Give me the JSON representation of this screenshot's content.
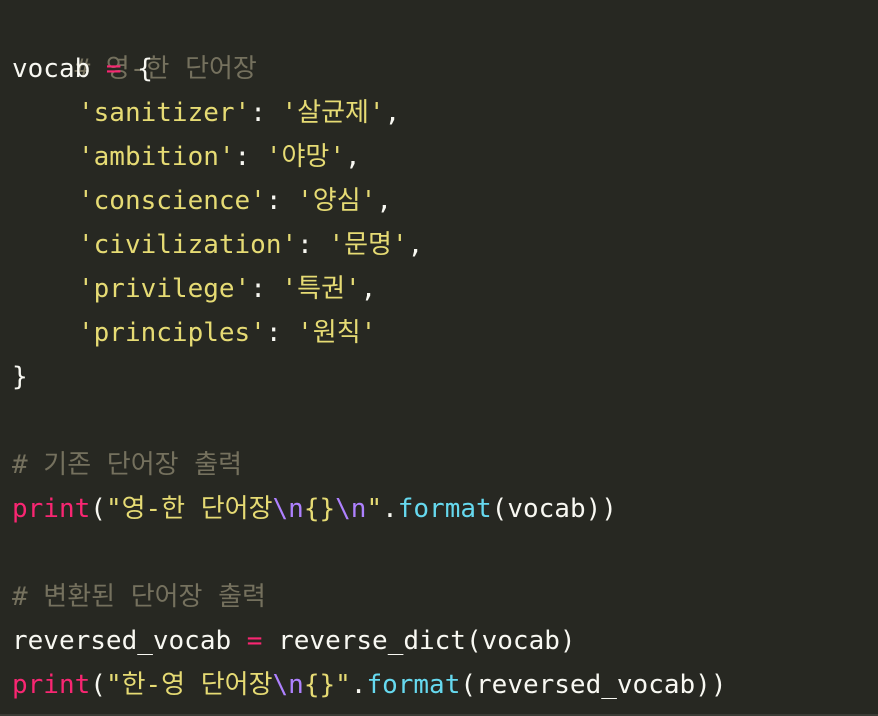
{
  "editor": {
    "colors": {
      "background": "#272822",
      "comment": "#75715e",
      "text": "#f8f8f2",
      "keyword": "#f92672",
      "string": "#e6db74",
      "escape": "#ae81ff",
      "method": "#66d9ef"
    },
    "lines": [
      {
        "comment": "# 영-한 단어장"
      },
      {
        "var": "vocab",
        "op": " = ",
        "brace": "{"
      },
      {
        "key": "'sanitizer'",
        "colon": ": ",
        "val": "'살균제'",
        "comma": ","
      },
      {
        "key": "'ambition'",
        "colon": ": ",
        "val": "'야망'",
        "comma": ","
      },
      {
        "key": "'conscience'",
        "colon": ": ",
        "val": "'양심'",
        "comma": ","
      },
      {
        "key": "'civilization'",
        "colon": ": ",
        "val": "'문명'",
        "comma": ","
      },
      {
        "key": "'privilege'",
        "colon": ": ",
        "val": "'특권'",
        "comma": ","
      },
      {
        "key": "'principles'",
        "colon": ": ",
        "val": "'원칙'"
      },
      {
        "brace": "}"
      },
      {},
      {
        "comment": "# 기존 단어장 출력"
      },
      {
        "fn": "print",
        "open": "(",
        "str1": "\"영-한 단어장",
        "esc1": "\\n",
        "str2": "{}",
        "esc2": "\\n",
        "str3": "\"",
        "dot": ".",
        "method": "format",
        "args": "(vocab))"
      },
      {},
      {
        "comment": "# 변환된 단어장 출력"
      },
      {
        "var": "reversed_vocab",
        "op": " = ",
        "rhs": "reverse_dict(vocab)"
      },
      {
        "fn": "print",
        "open": "(",
        "str1": "\"한-영 단어장",
        "esc1": "\\n",
        "str2": "{}\"",
        "dot": ".",
        "method": "format",
        "args": "(reversed_vocab))"
      }
    ]
  }
}
